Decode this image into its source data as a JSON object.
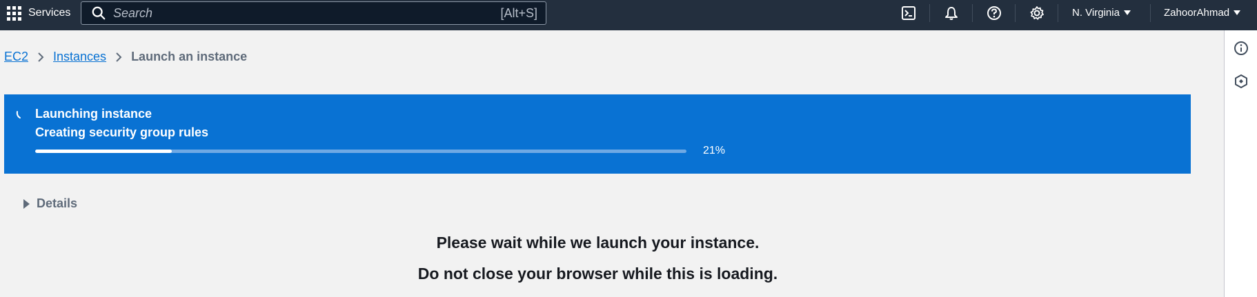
{
  "topnav": {
    "services_label": "Services",
    "search_placeholder": "Search",
    "search_shortcut": "[Alt+S]",
    "region": "N. Virginia",
    "user": "ZahoorAhmad"
  },
  "breadcrumb": {
    "items": [
      "EC2",
      "Instances"
    ],
    "current": "Launch an instance"
  },
  "flash": {
    "title": "Launching instance",
    "subtitle": "Creating security group rules",
    "progress_percent": 21,
    "progress_text": "21%"
  },
  "details": {
    "label": "Details"
  },
  "messages": {
    "line1": "Please wait while we launch your instance.",
    "line2": "Do not close your browser while this is loading."
  },
  "colors": {
    "nav_bg": "#232f3e",
    "accent_blue": "#0972d3",
    "page_bg": "#f2f2f2"
  }
}
